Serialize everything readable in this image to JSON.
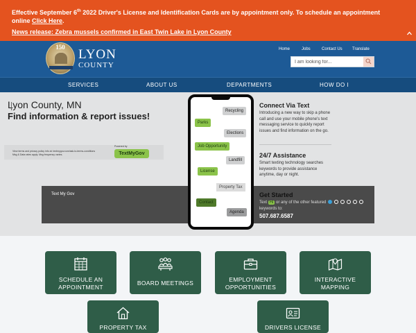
{
  "alert": {
    "line1_part1": "Effective September 6",
    "line1_sup": "th",
    "line1_part2": " 2022 Driver's License and Identification Cards are by appointment only. To schedule an appointment online ",
    "line1_link": "Click Here",
    "line1_end": ".",
    "line2_link": "News release: Zebra mussels confirmed in East Twin Lake in Lyon County",
    "collapse_icon": "chevron-up-icon"
  },
  "header": {
    "logo_number": "150",
    "logo_line1": "LYON",
    "logo_line2": "COUNTY",
    "util_links": [
      "Home",
      "Jobs",
      "Contact Us",
      "Translate"
    ],
    "search_placeholder": "I am looking for...",
    "search_icon": "search-icon"
  },
  "nav": [
    "SERVICES",
    "ABOUT US",
    "DEPARTMENTS",
    "HOW DO I"
  ],
  "hero": {
    "title1": "Lyon County, MN",
    "title2": "Find information & report issues!",
    "terms_line1": "View terms and privacy policy info at: textmygov.com/ask-to-terms-conditions",
    "terms_line2": "Msg & Data rates apply. Msg frequency varies.",
    "powered_by": "Powered by",
    "badge": "TextMyGov",
    "strip_label": "Text My Gov",
    "phone_bubbles": [
      {
        "text": "Recycling",
        "style": "grey"
      },
      {
        "text": "Parks",
        "style": "green"
      },
      {
        "text": "Elections",
        "style": "grey"
      },
      {
        "text": "Job Opportunity",
        "style": "green"
      },
      {
        "text": "Landfill",
        "style": "grey"
      },
      {
        "text": "License",
        "style": "green"
      },
      {
        "text": "Property Tax",
        "style": "light"
      },
      {
        "text": "Contact",
        "style": "green-dim"
      },
      {
        "text": "Agenda",
        "style": "grey-dim"
      }
    ],
    "connect_heading": "Connect Via Text",
    "connect_text": "Introducing a new way to skip a phone call and use your mobile phone's text messaging service to quickly report issues and find information on the go.",
    "assist_heading": "24/7 Assistance",
    "assist_text": "Smart texting technology searches keywords to provide assistance anytime, day or night.",
    "start_heading": "Get Started",
    "start_text_before": "Text ",
    "start_keyword": "Hi",
    "start_text_after": " or any of the other featured keywords to:",
    "phone_number": "507.687.6587",
    "slide_count": 6,
    "active_slide": 1
  },
  "tiles": [
    {
      "label_line1": "SCHEDULE AN",
      "label_line2": "APPOINTMENT",
      "icon": "calendar-icon"
    },
    {
      "label_line1": "BOARD MEETINGS",
      "label_line2": "",
      "icon": "meeting-icon"
    },
    {
      "label_line1": "EMPLOYMENT",
      "label_line2": "OPPORTUNITIES",
      "icon": "briefcase-icon"
    },
    {
      "label_line1": "INTERACTIVE",
      "label_line2": "MAPPING",
      "icon": "map-icon"
    },
    {
      "label_line1": "PROPERTY TAX",
      "label_line2": "",
      "icon": "house-icon"
    },
    {
      "label_line1": "DRIVERS LICENSE",
      "label_line2": "",
      "icon": "id-card-icon"
    }
  ]
}
